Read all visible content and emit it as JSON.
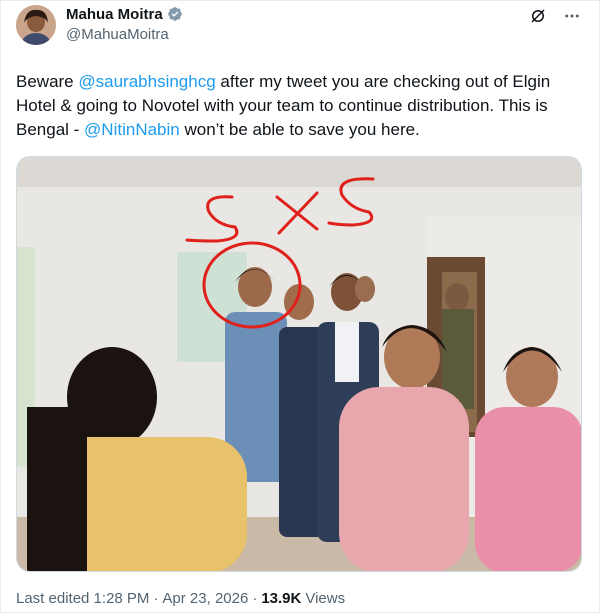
{
  "author": {
    "display_name": "Mahua Moitra",
    "handle": "@MahuaMoitra",
    "verified": true,
    "avatar_icon": "profile-photo"
  },
  "actions": {
    "grok_icon": "grok-icon",
    "more_icon": "more-dots-icon"
  },
  "tweet": {
    "segments": [
      {
        "type": "text",
        "value": "Beware "
      },
      {
        "type": "mention",
        "value": "@saurabhsinghcg"
      },
      {
        "type": "text",
        "value": " after my tweet you are checking out of Elgin Hotel & going to Novotel with your team to continue distribution. This is Bengal - "
      },
      {
        "type": "mention",
        "value": "@NitinNabin"
      },
      {
        "type": "text",
        "value": " won’t be able to save you here."
      }
    ]
  },
  "media": {
    "annotation_text": "S X S"
  },
  "meta": {
    "edited_label": "Last edited 1:28 PM",
    "separator": "·",
    "date": "Apr 23, 2026",
    "views_count": "13.9K",
    "views_label": "Views"
  },
  "colors": {
    "link": "#1d9bf0",
    "secondary_text": "#536471",
    "annotation_red": "#e0201b"
  }
}
